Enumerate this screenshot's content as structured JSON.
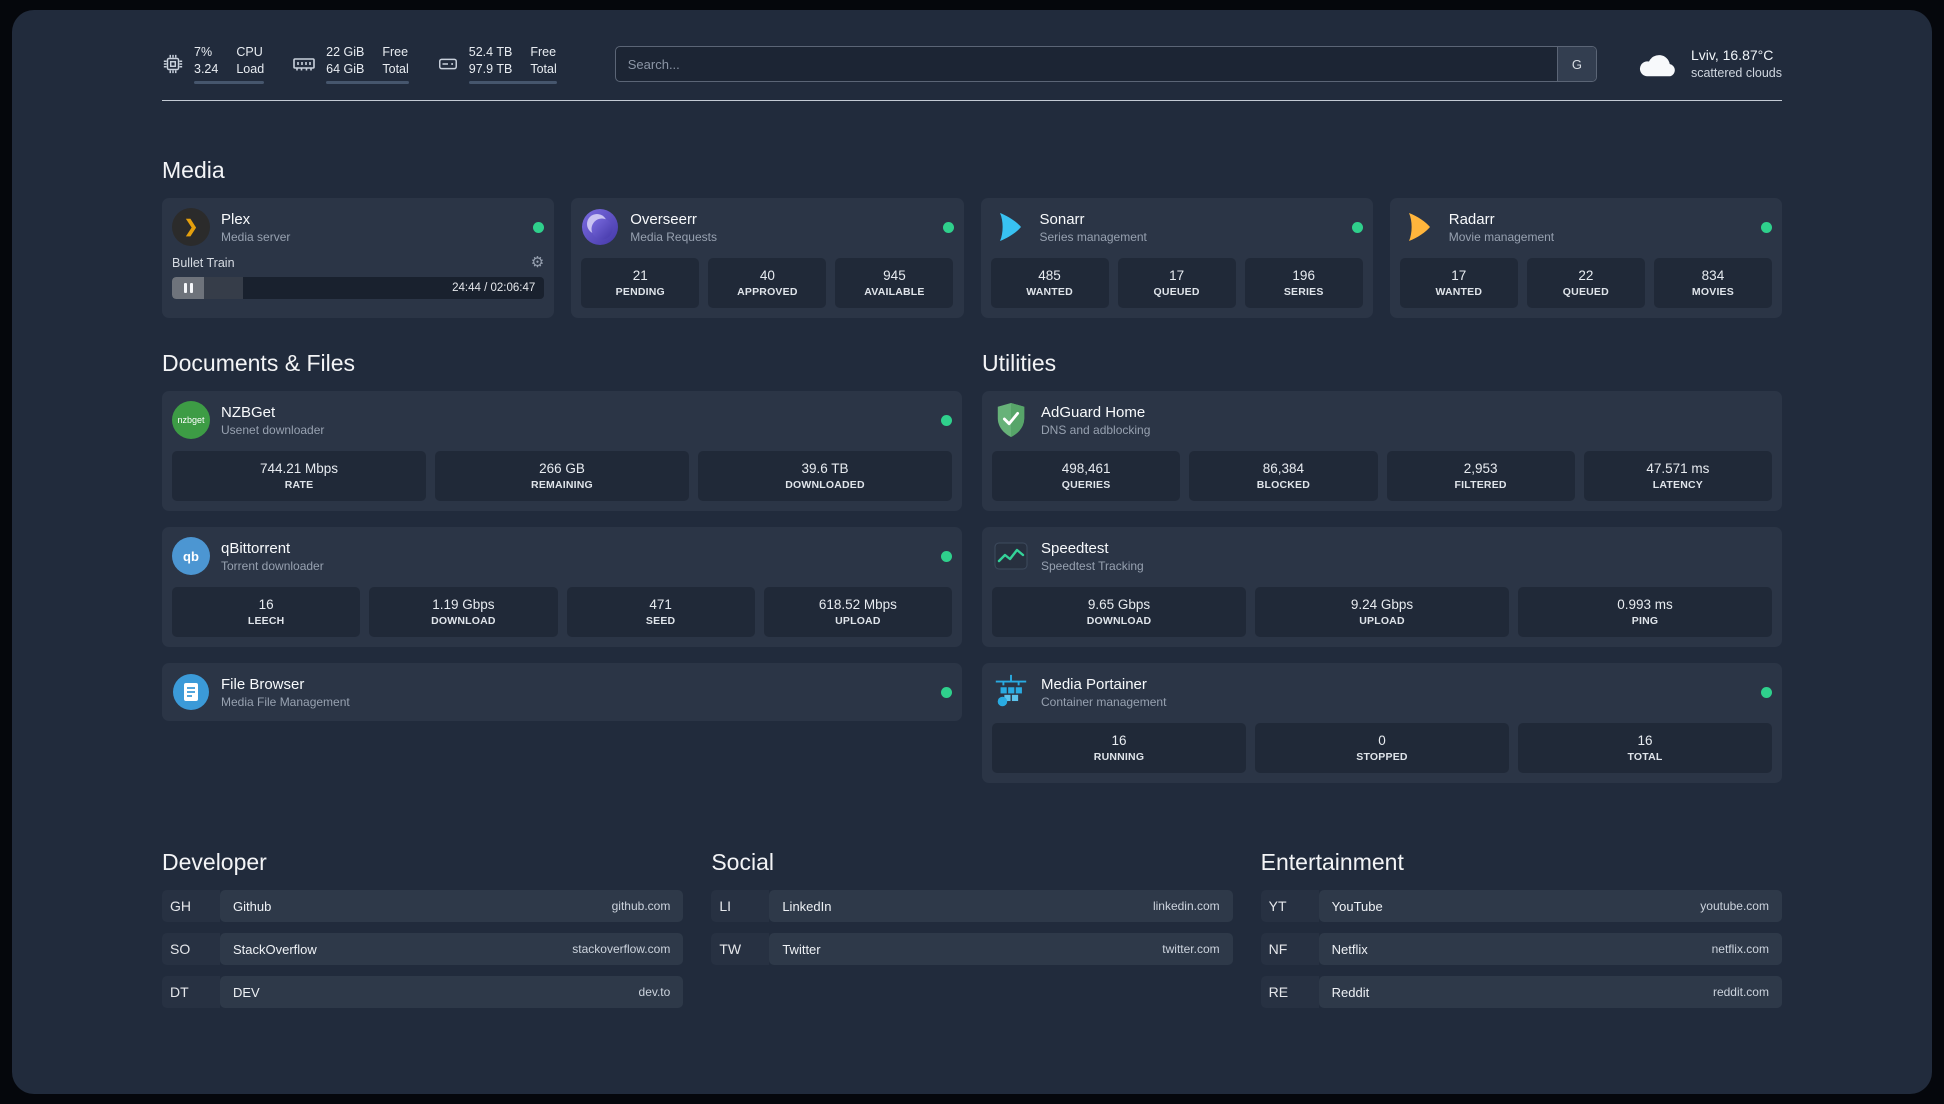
{
  "icons": {
    "plex_chevron": "❯",
    "gear": "⚙",
    "nzbget_text": "nzbget",
    "qbittorrent_text": "qb"
  },
  "header": {
    "cpu": {
      "value_top": "7%",
      "value_bottom": "3.24",
      "label_top": "CPU",
      "label_bottom": "Load",
      "bar_pct": 7
    },
    "memory": {
      "value_top": "22 GiB",
      "value_bottom": "64 GiB",
      "label_top": "Free",
      "label_bottom": "Total",
      "bar_pct": 66
    },
    "disk": {
      "value_top": "52.4 TB",
      "value_bottom": "97.9 TB",
      "label_top": "Free",
      "label_bottom": "Total",
      "bar_pct": 46
    },
    "search": {
      "placeholder": "Search...",
      "provider_label": "G"
    },
    "weather": {
      "location": "Lviv, 16.87°C",
      "description": "scattered clouds"
    }
  },
  "sections": {
    "media": {
      "title": "Media",
      "plex": {
        "name": "Plex",
        "subtitle": "Media server",
        "now_playing": "Bullet Train",
        "time": "24:44 / 02:06:47",
        "progress_pct": 19
      },
      "overseerr": {
        "name": "Overseerr",
        "subtitle": "Media Requests",
        "stats": [
          {
            "value": "21",
            "label": "PENDING"
          },
          {
            "value": "40",
            "label": "APPROVED"
          },
          {
            "value": "945",
            "label": "AVAILABLE"
          }
        ]
      },
      "sonarr": {
        "name": "Sonarr",
        "subtitle": "Series management",
        "stats": [
          {
            "value": "485",
            "label": "WANTED"
          },
          {
            "value": "17",
            "label": "QUEUED"
          },
          {
            "value": "196",
            "label": "SERIES"
          }
        ]
      },
      "radarr": {
        "name": "Radarr",
        "subtitle": "Movie management",
        "stats": [
          {
            "value": "17",
            "label": "WANTED"
          },
          {
            "value": "22",
            "label": "QUEUED"
          },
          {
            "value": "834",
            "label": "MOVIES"
          }
        ]
      }
    },
    "documents": {
      "title": "Documents & Files",
      "nzbget": {
        "name": "NZBGet",
        "subtitle": "Usenet downloader",
        "stats": [
          {
            "value": "744.21 Mbps",
            "label": "RATE"
          },
          {
            "value": "266 GB",
            "label": "REMAINING"
          },
          {
            "value": "39.6 TB",
            "label": "DOWNLOADED"
          }
        ]
      },
      "qbittorrent": {
        "name": "qBittorrent",
        "subtitle": "Torrent downloader",
        "stats": [
          {
            "value": "16",
            "label": "LEECH"
          },
          {
            "value": "1.19 Gbps",
            "label": "DOWNLOAD"
          },
          {
            "value": "471",
            "label": "SEED"
          },
          {
            "value": "618.52 Mbps",
            "label": "UPLOAD"
          }
        ]
      },
      "filebrowser": {
        "name": "File Browser",
        "subtitle": "Media File Management"
      }
    },
    "utilities": {
      "title": "Utilities",
      "adguard": {
        "name": "AdGuard Home",
        "subtitle": "DNS and adblocking",
        "stats": [
          {
            "value": "498,461",
            "label": "QUERIES"
          },
          {
            "value": "86,384",
            "label": "BLOCKED"
          },
          {
            "value": "2,953",
            "label": "FILTERED"
          },
          {
            "value": "47.571 ms",
            "label": "LATENCY"
          }
        ]
      },
      "speedtest": {
        "name": "Speedtest",
        "subtitle": "Speedtest Tracking",
        "stats": [
          {
            "value": "9.65 Gbps",
            "label": "DOWNLOAD"
          },
          {
            "value": "9.24 Gbps",
            "label": "UPLOAD"
          },
          {
            "value": "0.993 ms",
            "label": "PING"
          }
        ]
      },
      "portainer": {
        "name": "Media Portainer",
        "subtitle": "Container management",
        "stats": [
          {
            "value": "16",
            "label": "RUNNING"
          },
          {
            "value": "0",
            "label": "STOPPED"
          },
          {
            "value": "16",
            "label": "TOTAL"
          }
        ]
      }
    }
  },
  "bookmarks": {
    "developer": {
      "title": "Developer",
      "items": [
        {
          "abbr": "GH",
          "name": "Github",
          "url": "github.com"
        },
        {
          "abbr": "SO",
          "name": "StackOverflow",
          "url": "stackoverflow.com"
        },
        {
          "abbr": "DT",
          "name": "DEV",
          "url": "dev.to"
        }
      ]
    },
    "social": {
      "title": "Social",
      "items": [
        {
          "abbr": "LI",
          "name": "LinkedIn",
          "url": "linkedin.com"
        },
        {
          "abbr": "TW",
          "name": "Twitter",
          "url": "twitter.com"
        }
      ]
    },
    "entertainment": {
      "title": "Entertainment",
      "items": [
        {
          "abbr": "YT",
          "name": "YouTube",
          "url": "youtube.com"
        },
        {
          "abbr": "NF",
          "name": "Netflix",
          "url": "netflix.com"
        },
        {
          "abbr": "RE",
          "name": "Reddit",
          "url": "reddit.com"
        }
      ]
    }
  }
}
